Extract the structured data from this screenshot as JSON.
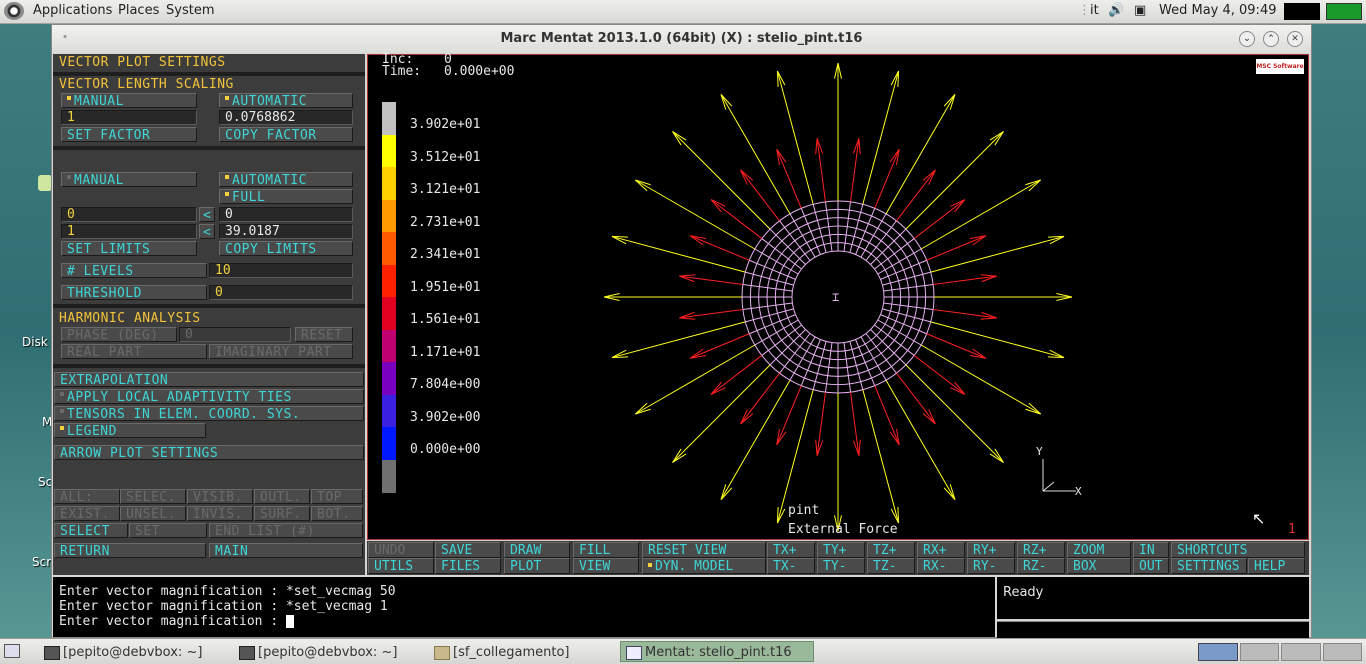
{
  "top_panel": {
    "menus": [
      "Applications",
      "Places",
      "System"
    ],
    "keyboard_layout": "it",
    "clock": "Wed May  4, 09:49"
  },
  "desktop": {
    "labels": [
      "Disk",
      "M",
      "Sc",
      "Scr"
    ]
  },
  "window": {
    "title": "Marc Mentat 2013.1.0 (64bit) (X) : stelio_pint.t16",
    "controls": [
      "⌄",
      "⌃",
      "✕"
    ]
  },
  "panel": {
    "title": "VECTOR PLOT SETTINGS",
    "length_scaling": {
      "header": "VECTOR LENGTH SCALING",
      "manual": "MANUAL",
      "automatic": "AUTOMATIC",
      "factor_value": "1",
      "auto_value": "0.0768862",
      "set_factor": "SET FACTOR",
      "copy_factor": "COPY FACTOR"
    },
    "limits": {
      "manual": "MANUAL",
      "automatic": "AUTOMATIC",
      "full": "FULL",
      "min_manual": "0",
      "min_auto": "0",
      "max_manual": "1",
      "max_auto": "39.0187",
      "arrow": "<",
      "set_limits": "SET LIMITS",
      "copy_limits": "COPY LIMITS"
    },
    "levels_label": "# LEVELS",
    "levels_value": "10",
    "threshold_label": "THRESHOLD",
    "threshold_value": "0",
    "harmonic": {
      "header": "HARMONIC ANALYSIS",
      "phase": "PHASE (DEG)",
      "phase_value": "0",
      "reset": "RESET",
      "real_part": "REAL PART",
      "imaginary_part": "IMAGINARY PART"
    },
    "extrapolation": "EXTRAPOLATION",
    "adaptivity": "APPLY LOCAL ADAPTIVITY TIES",
    "tensors": "TENSORS IN ELEM. COORD. SYS.",
    "legend": "LEGEND",
    "arrow_plot": "ARROW PLOT SETTINGS",
    "sel_row1": [
      "ALL:",
      "SELEC.",
      "VISIB.",
      "OUTL.",
      "TOP"
    ],
    "sel_row2": [
      "EXIST.",
      "UNSEL.",
      "INVIS.",
      "SURF.",
      "BOT."
    ],
    "select": "SELECT",
    "set": "SET",
    "end_list": "END LIST (#)",
    "return": "RETURN",
    "main": "MAIN"
  },
  "graphics": {
    "inc_label": "Inc:",
    "inc_value": "0",
    "time_label": "Time:",
    "time_value": "0.000e+00",
    "logo": "MSC Software",
    "legend_values": [
      "3.902e+01",
      "3.512e+01",
      "3.121e+01",
      "2.731e+01",
      "2.341e+01",
      "1.951e+01",
      "1.561e+01",
      "1.171e+01",
      "7.804e+00",
      "3.902e+00",
      "0.000e+00"
    ],
    "legend_colors": [
      "#c0c0c0",
      "#ffff00",
      "#ffd000",
      "#ff9a00",
      "#ff5a00",
      "#ff2000",
      "#e00020",
      "#c00070",
      "#7a00c0",
      "#3a20e0",
      "#0018ff",
      "#707070"
    ],
    "job_name": "pint",
    "plot_label": "External Force",
    "axis_x": "X",
    "axis_y": "Y",
    "corner_number": "1"
  },
  "bottom_bar": {
    "row1": [
      "UNDO",
      "SAVE",
      "DRAW",
      "FILL",
      "RESET VIEW",
      "TX+",
      "TY+",
      "TZ+",
      "RX+",
      "RY+",
      "RZ+",
      "ZOOM",
      "IN",
      "SHORTCUTS"
    ],
    "row2": [
      "UTILS",
      "FILES",
      "PLOT",
      "VIEW",
      "DYN. MODEL",
      "TX-",
      "TY-",
      "TZ-",
      "RX-",
      "RY-",
      "RZ-",
      "BOX",
      "OUT",
      "SETTINGS",
      "HELP"
    ]
  },
  "console": {
    "lines": [
      "Enter vector magnification : *set_vecmag 50",
      "Enter vector magnification : *set_vecmag 1",
      "Enter vector magnification : "
    ]
  },
  "status": "Ready",
  "taskbar": {
    "tasks": [
      "[pepito@debvbox: ~]",
      "[pepito@debvbox: ~]",
      "[sf_collegamento]",
      "Mentat: stelio_pint.t16"
    ]
  }
}
